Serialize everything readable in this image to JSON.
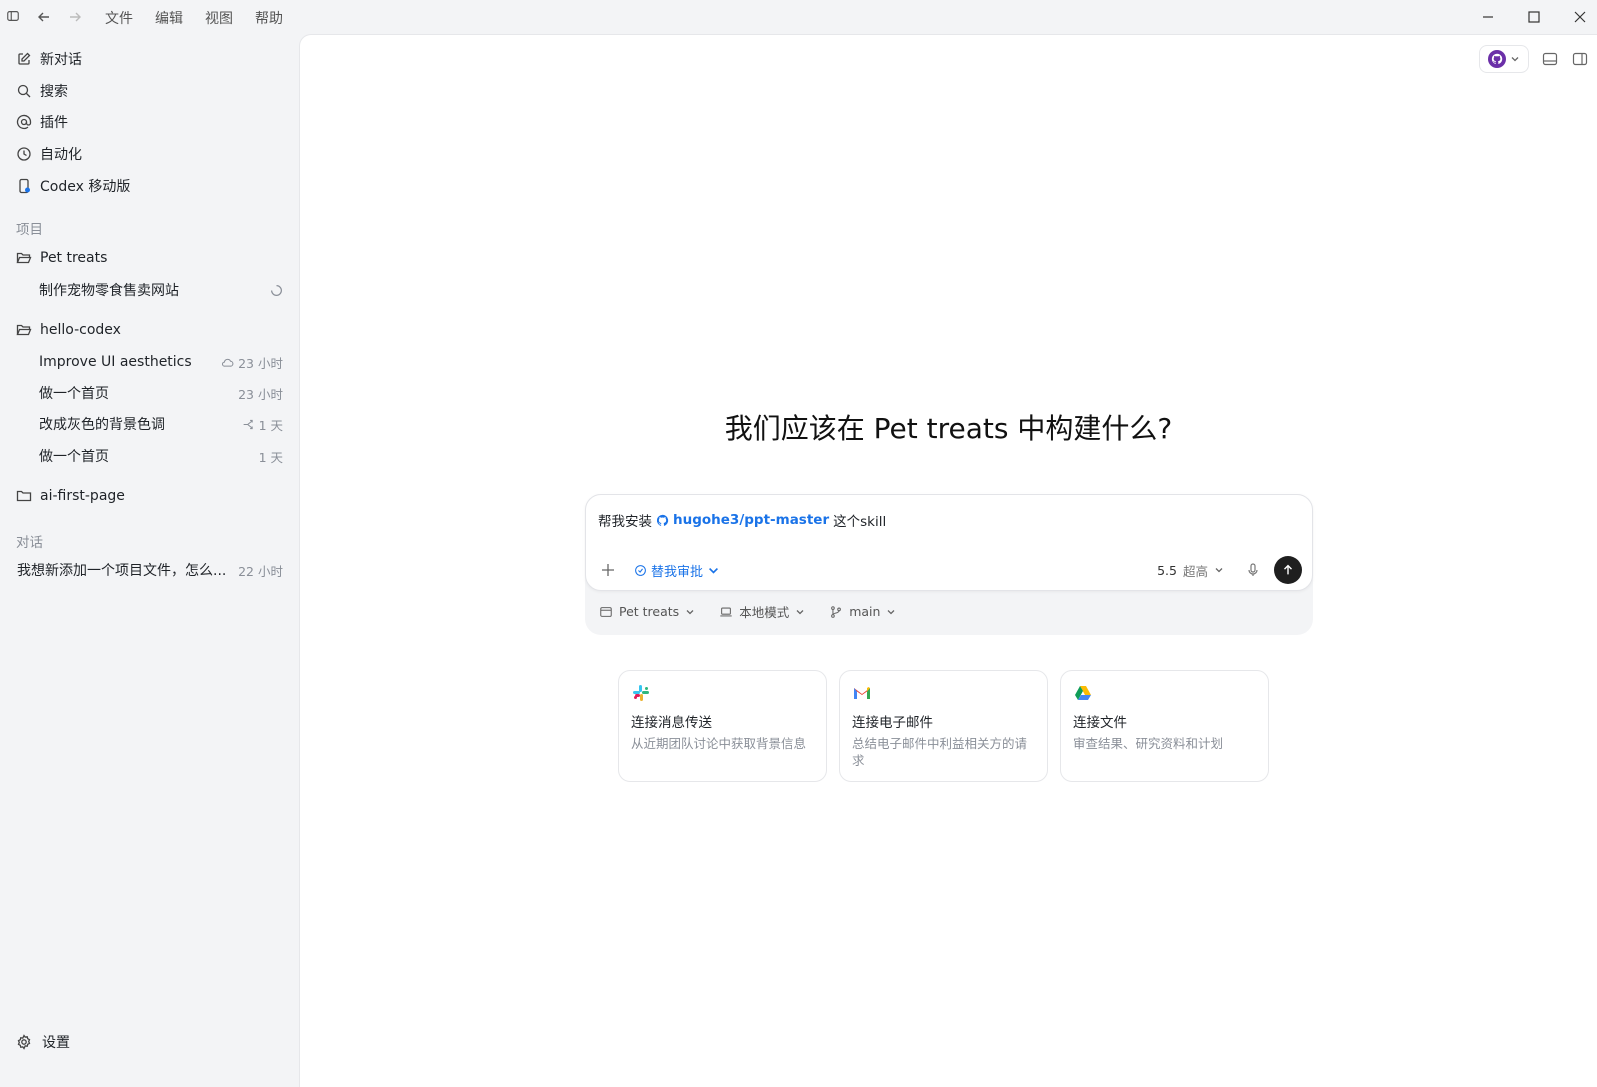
{
  "menu": [
    "文件",
    "编辑",
    "视图",
    "帮助"
  ],
  "sidebar": {
    "nav": [
      {
        "label": "新对话",
        "icon": "edit-icon"
      },
      {
        "label": "搜索",
        "icon": "search-icon"
      },
      {
        "label": "插件",
        "icon": "at-icon"
      },
      {
        "label": "自动化",
        "icon": "clock-icon"
      },
      {
        "label": "Codex 移动版",
        "icon": "phone-icon"
      }
    ],
    "projects_label": "项目",
    "projects": [
      {
        "name": "Pet treats",
        "threads": [
          {
            "title": "制作宠物零食售卖网站",
            "meta": "",
            "status": "loading-spinner"
          }
        ]
      },
      {
        "name": "hello-codex",
        "threads": [
          {
            "title": "Improve UI aesthetics",
            "meta": "23 小时",
            "status": "cloud-icon"
          },
          {
            "title": "做一个首页",
            "meta": "23 小时",
            "status": ""
          },
          {
            "title": "改成灰色的背景色调",
            "meta": "1 天",
            "status": "branch-icon"
          },
          {
            "title": "做一个首页",
            "meta": "1 天",
            "status": ""
          }
        ]
      },
      {
        "name": "ai-first-page",
        "threads": []
      }
    ],
    "conversations_label": "对话",
    "conversations": [
      {
        "title": "我想新添加一个项目文件，怎么...",
        "meta": "22 小时"
      }
    ],
    "settings_label": "设置"
  },
  "main": {
    "headline": "我们应该在 Pet treats 中构建什么?",
    "composer": {
      "prefix": "帮我安装",
      "repo": "hugohe3/ppt-master",
      "suffix": "这个skill",
      "approval": "替我审批",
      "model": "5.5",
      "level": "超高"
    },
    "footer": {
      "project": "Pet treats",
      "mode": "本地模式",
      "branch": "main"
    },
    "cards": [
      {
        "title": "连接消息传送",
        "desc": "从近期团队讨论中获取背景信息",
        "logo": "slack-icon"
      },
      {
        "title": "连接电子邮件",
        "desc": "总结电子邮件中利益相关方的请求",
        "logo": "gmail-icon"
      },
      {
        "title": "连接文件",
        "desc": "审查结果、研究资料和计划",
        "logo": "google-drive-icon"
      }
    ]
  }
}
